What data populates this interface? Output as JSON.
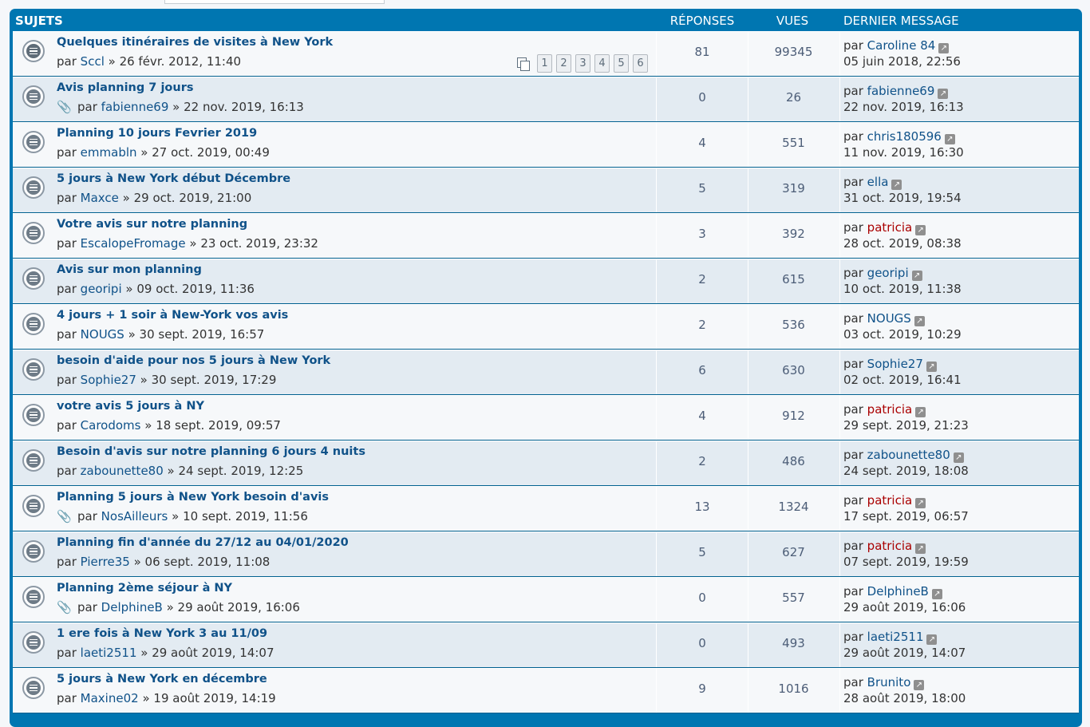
{
  "header": {
    "topics": "SUJETS",
    "replies": "RÉPONSES",
    "views": "VUES",
    "last_post": "DERNIER MESSAGE"
  },
  "icons": {
    "topic": "topic-read-icon",
    "announce": "announcement-icon",
    "attachment": "paperclip-icon",
    "goto_last": "goto-last-post-icon",
    "pages": "pages-icon"
  },
  "colors": {
    "header_blue": "#0076b1",
    "link_blue": "#105289",
    "moderator_red": "#aa0000"
  },
  "topics": [
    {
      "title": "Quelques itinéraires de visites à New York",
      "prefix": "par",
      "author": "Sccl",
      "date": " » 26 févr. 2012, 11:40",
      "replies": "81",
      "views": "99345",
      "last_prefix": "par",
      "last_user": "Caroline 84",
      "last_date": "05 juin 2018, 22:56",
      "pages": [
        "1",
        "2",
        "3",
        "4",
        "5",
        "6"
      ]
    },
    {
      "title": "Avis planning 7 jours",
      "prefix": "par",
      "author": "fabienne69",
      "date": " » 22 nov. 2019, 16:13",
      "replies": "0",
      "views": "26",
      "last_prefix": "par",
      "last_user": "fabienne69",
      "last_date": "22 nov. 2019, 16:13"
    },
    {
      "title": "Planning 10 jours Fevrier 2019",
      "prefix": "par",
      "author": "emmabln",
      "date": " » 27 oct. 2019, 00:49",
      "replies": "4",
      "views": "551",
      "last_prefix": "par",
      "last_user": "chris180596",
      "last_date": "11 nov. 2019, 16:30"
    },
    {
      "title": "5 jours à New York début Décembre",
      "prefix": "par",
      "author": "Maxce",
      "date": " » 29 oct. 2019, 21:00",
      "replies": "5",
      "views": "319",
      "last_prefix": "par",
      "last_user": "ella",
      "last_date": "31 oct. 2019, 19:54"
    },
    {
      "title": "Votre avis sur notre planning",
      "prefix": "par",
      "author": "EscalopeFromage",
      "date": " » 23 oct. 2019, 23:32",
      "replies": "3",
      "views": "392",
      "last_prefix": "par",
      "last_user": "patricia",
      "last_date": "28 oct. 2019, 08:38"
    },
    {
      "title": "Avis sur mon planning",
      "prefix": "par",
      "author": "georipi",
      "date": " » 09 oct. 2019, 11:36",
      "replies": "2",
      "views": "615",
      "last_prefix": "par",
      "last_user": "georipi",
      "last_date": "10 oct. 2019, 11:38"
    },
    {
      "title": "4 jours + 1 soir à New-York vos avis",
      "prefix": "par",
      "author": "NOUGS",
      "date": " » 30 sept. 2019, 16:57",
      "replies": "2",
      "views": "536",
      "last_prefix": "par",
      "last_user": "NOUGS",
      "last_date": "03 oct. 2019, 10:29"
    },
    {
      "title": "besoin d'aide pour nos 5 jours à New York",
      "prefix": "par",
      "author": "Sophie27",
      "date": " » 30 sept. 2019, 17:29",
      "replies": "6",
      "views": "630",
      "last_prefix": "par",
      "last_user": "Sophie27",
      "last_date": "02 oct. 2019, 16:41"
    },
    {
      "title": "votre avis 5 jours à NY",
      "prefix": "par",
      "author": "Carodoms",
      "date": " » 18 sept. 2019, 09:57",
      "replies": "4",
      "views": "912",
      "last_prefix": "par",
      "last_user": "patricia",
      "last_date": "29 sept. 2019, 21:23"
    },
    {
      "title": "Besoin d'avis sur notre planning 6 jours 4 nuits",
      "prefix": "par",
      "author": "zabounette80",
      "date": " » 24 sept. 2019, 12:25",
      "replies": "2",
      "views": "486",
      "last_prefix": "par",
      "last_user": "zabounette80",
      "last_date": "24 sept. 2019, 18:08"
    },
    {
      "title": "Planning 5 jours à New York besoin d'avis",
      "prefix": "par",
      "author": "NosAilleurs",
      "date": " » 10 sept. 2019, 11:56",
      "replies": "13",
      "views": "1324",
      "last_prefix": "par",
      "last_user": "patricia",
      "last_date": "17 sept. 2019, 06:57"
    },
    {
      "title": "Planning fin d'année du 27/12 au 04/01/2020",
      "prefix": "par",
      "author": "Pierre35",
      "date": " » 06 sept. 2019, 11:08",
      "replies": "5",
      "views": "627",
      "last_prefix": "par",
      "last_user": "patricia",
      "last_date": "07 sept. 2019, 19:59"
    },
    {
      "title": "Planning 2ème séjour à NY",
      "prefix": "par",
      "author": "DelphineB",
      "date": " » 29 août 2019, 16:06",
      "replies": "0",
      "views": "557",
      "last_prefix": "par",
      "last_user": "DelphineB",
      "last_date": "29 août 2019, 16:06"
    },
    {
      "title": "1 ere fois à New York 3 au 11/09",
      "prefix": "par",
      "author": "laeti2511",
      "date": " » 29 août 2019, 14:07",
      "replies": "0",
      "views": "493",
      "last_prefix": "par",
      "last_user": "laeti2511",
      "last_date": "29 août 2019, 14:07"
    },
    {
      "title": "5 jours à New York en décembre",
      "prefix": "par",
      "author": "Maxine02",
      "date": " » 19 août 2019, 14:19",
      "replies": "9",
      "views": "1016",
      "last_prefix": "par",
      "last_user": "Brunito",
      "last_date": "28 août 2019, 18:00"
    }
  ]
}
